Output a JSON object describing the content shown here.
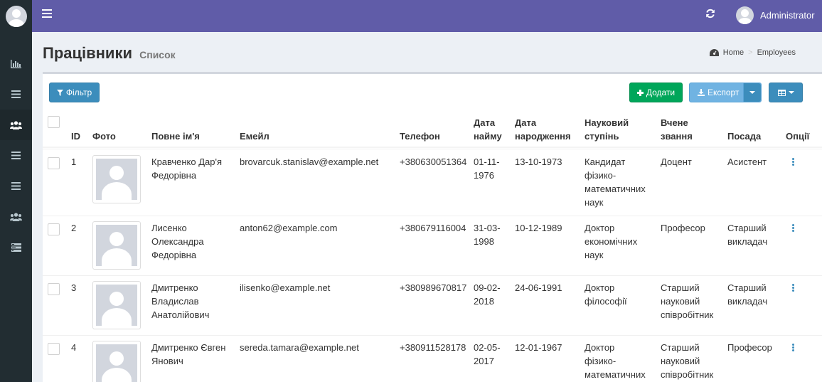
{
  "topbar": {
    "user_name": "Administrator",
    "menu_icon": "hamburger-icon",
    "refresh_icon": "refresh-icon"
  },
  "sidebar": {
    "items": [
      {
        "icon": "bar-chart-icon"
      },
      {
        "icon": "list-icon"
      },
      {
        "icon": "users-icon",
        "active": true
      },
      {
        "icon": "list-icon"
      },
      {
        "icon": "list-icon"
      },
      {
        "icon": "users-icon"
      },
      {
        "icon": "tasks-icon"
      }
    ]
  },
  "header": {
    "title": "Працівники",
    "subtitle": "Список",
    "breadcrumb": [
      "Home",
      "Employees"
    ]
  },
  "toolbar": {
    "filter_label": "Фільтр",
    "add_label": "Додати",
    "export_label": "Експорт"
  },
  "table": {
    "columns": {
      "id": "ID",
      "photo": "Фото",
      "name": "Повне ім'я",
      "email": "Емейл",
      "phone": "Телефон",
      "hire_date_1": "Дата",
      "hire_date_2": "найму",
      "birth_date_1": "Дата",
      "birth_date_2": "народження",
      "degree_1": "Науковий",
      "degree_2": "ступінь",
      "title_1": "Вчене",
      "title_2": "звання",
      "position": "Посада",
      "options": "Опції"
    },
    "rows": [
      {
        "id": "1",
        "name": [
          "Кравченко Дар'я",
          "Федорівна"
        ],
        "email": "brovarcuk.stanislav@example.net",
        "phone": "+380630051364",
        "hire_date": [
          "01-11-",
          "1976"
        ],
        "birth_date": "13-10-1973",
        "degree": [
          "Кандидат",
          "фізико-",
          "математичних",
          "наук"
        ],
        "title": [
          "Доцент"
        ],
        "position": [
          "Асистент"
        ]
      },
      {
        "id": "2",
        "name": [
          "Лисенко",
          "Олександра",
          "Федорівна"
        ],
        "email": "anton62@example.com",
        "phone": "+380679116004",
        "hire_date": [
          "31-03-",
          "1998"
        ],
        "birth_date": "10-12-1989",
        "degree": [
          "Доктор",
          "економічних",
          "наук"
        ],
        "title": [
          "Професор"
        ],
        "position": [
          "Старший",
          "викладач"
        ]
      },
      {
        "id": "3",
        "name": [
          "Дмитренко",
          "Владислав",
          "Анатолійович"
        ],
        "email": "ilisenko@example.net",
        "phone": "+380989670817",
        "hire_date": [
          "09-02-",
          "2018"
        ],
        "birth_date": "24-06-1991",
        "degree": [
          "Доктор",
          "філософії"
        ],
        "title": [
          "Старший",
          "науковий",
          "співробітник"
        ],
        "position": [
          "Старший",
          "викладач"
        ]
      },
      {
        "id": "4",
        "name": [
          "Дмитренко Євген",
          "Янович"
        ],
        "email": "sereda.tamara@example.net",
        "phone": "+380911528178",
        "hire_date": [
          "02-05-",
          "2017"
        ],
        "birth_date": "12-01-1967",
        "degree": [
          "Доктор",
          "фізико-",
          "математичних"
        ],
        "title": [
          "Старший",
          "науковий",
          "співробітник"
        ],
        "position": [
          "Професор"
        ]
      }
    ]
  }
}
